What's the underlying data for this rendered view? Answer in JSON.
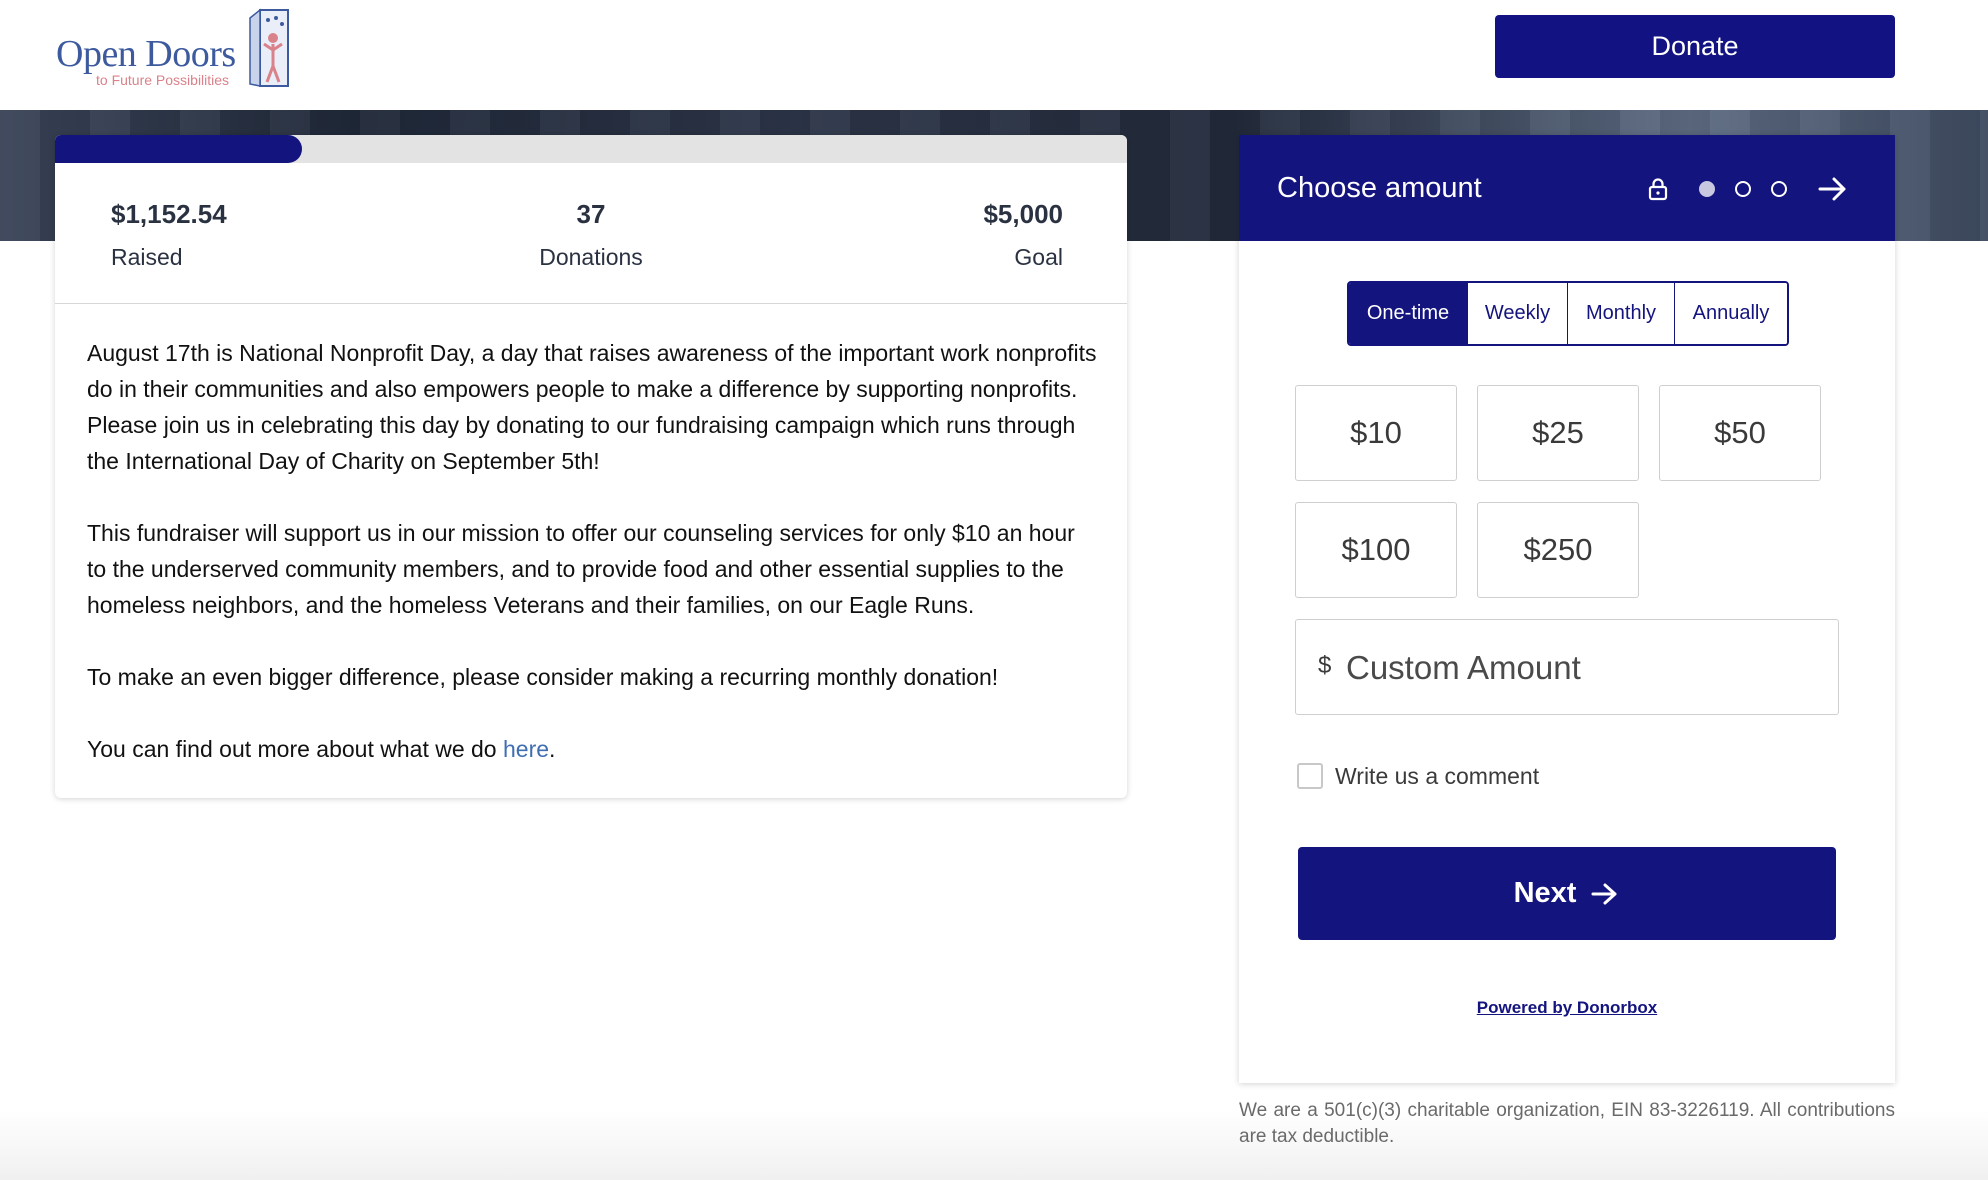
{
  "header": {
    "logo_name": "Open Doors",
    "logo_tagline": "to Future Possibilities",
    "donate_label": "Donate"
  },
  "campaign": {
    "progress_fraction": 0.23,
    "raised": {
      "value": "$1,152.54",
      "label": "Raised"
    },
    "donations": {
      "value": "37",
      "label": "Donations"
    },
    "goal": {
      "value": "$5,000",
      "label": "Goal"
    },
    "paragraphs": [
      "August 17th is National Nonprofit Day, a day that raises awareness of the important work nonprofits do in their communities and also empowers people to make a difference by supporting nonprofits. Please join us in celebrating this day by donating to our fundraising campaign which runs through the International Day of Charity on September 5th!",
      "This fundraiser will support us in our mission to offer our counseling services for only $10 an hour to the underserved community members, and to provide food and other essential supplies to the homeless neighbors, and the homeless Veterans and their families, on our Eagle Runs.",
      "To make an even bigger difference, please consider making a recurring monthly donation!"
    ],
    "more_prefix": "You can find out more about what we do ",
    "more_link": "here",
    "more_suffix": "."
  },
  "form": {
    "title": "Choose amount",
    "icons": [
      "lock-icon",
      "step-dot-icon",
      "arrow-right-icon"
    ],
    "steps": {
      "current": 1,
      "total": 3
    },
    "frequency_tabs": [
      "One-time",
      "Weekly",
      "Monthly",
      "Annually"
    ],
    "frequency_selected": "One-time",
    "amounts": [
      "$10",
      "$25",
      "$50",
      "$100",
      "$250"
    ],
    "custom_currency": "$",
    "custom_placeholder": "Custom Amount",
    "comment_label": "Write us a comment",
    "next_label": "Next",
    "powered_by": "Powered by Donorbox"
  },
  "footnote": "We are a 501(c)(3) charitable organization, EIN 83-3226119. All contributions are tax deductible.",
  "colors": {
    "primary": "#14147f",
    "link": "#3f6eb3",
    "track": "#e3e3e3"
  }
}
